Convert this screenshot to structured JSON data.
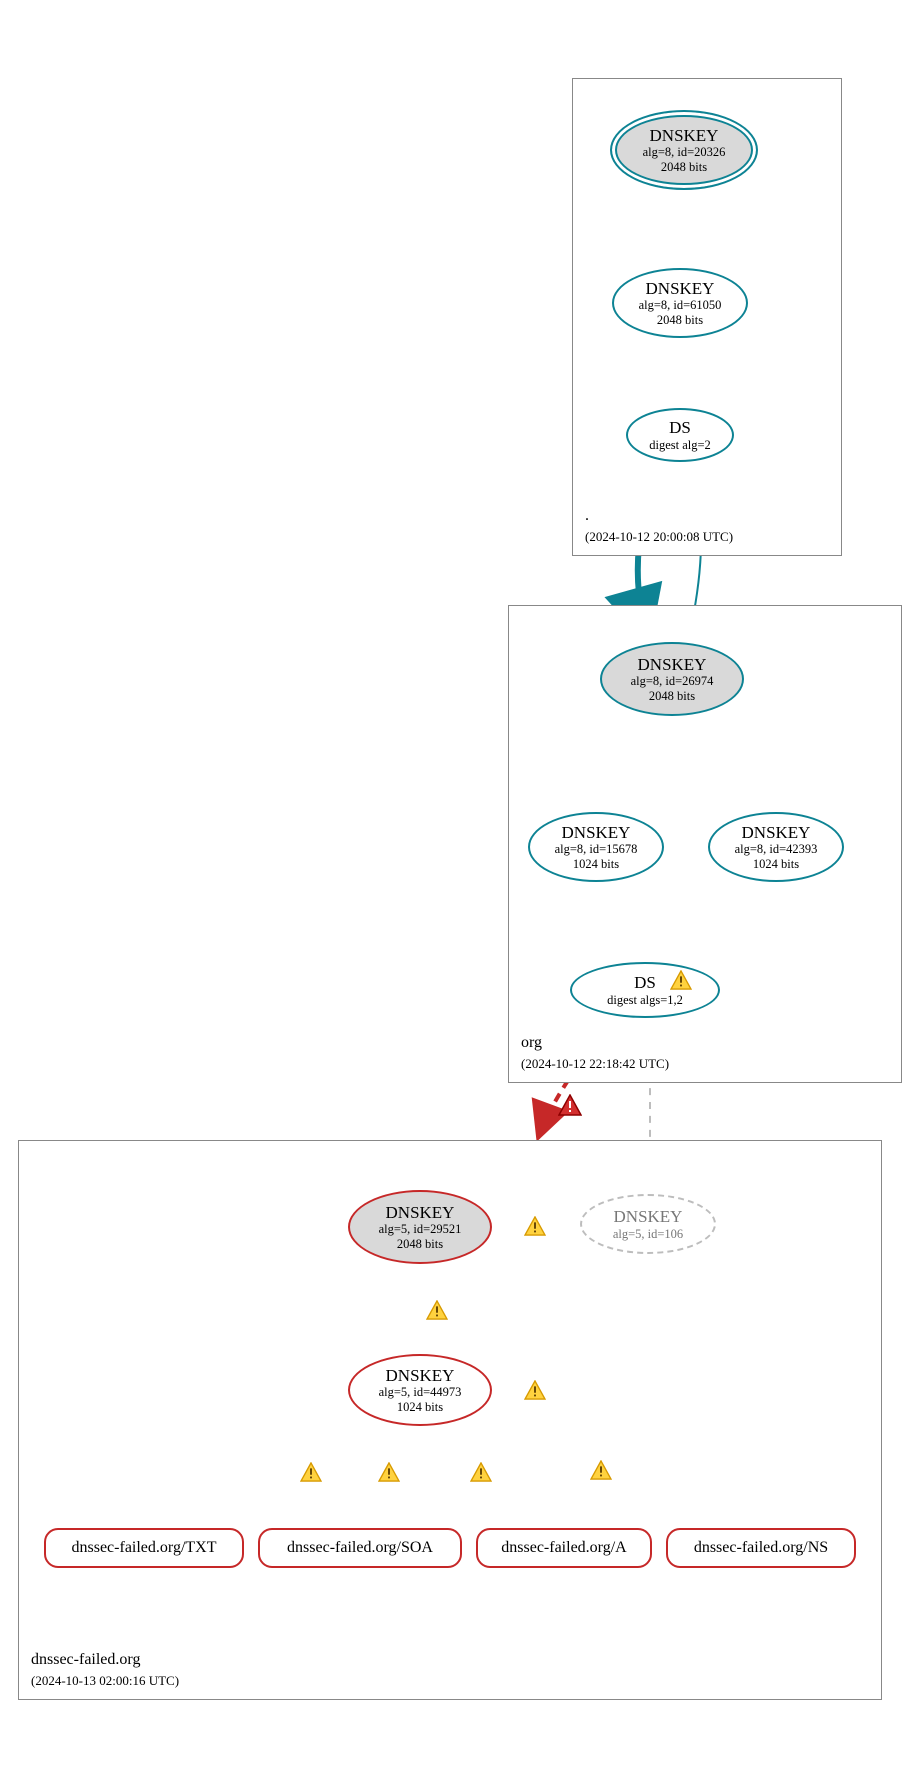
{
  "zones": {
    "root": {
      "name": ".",
      "timestamp": "(2024-10-12 20:00:08 UTC)"
    },
    "org": {
      "name": "org",
      "timestamp": "(2024-10-12 22:18:42 UTC)"
    },
    "failed": {
      "name": "dnssec-failed.org",
      "timestamp": "(2024-10-13 02:00:16 UTC)"
    }
  },
  "nodes": {
    "root_ksk": {
      "title": "DNSKEY",
      "line1": "alg=8, id=20326",
      "line2": "2048 bits"
    },
    "root_zsk": {
      "title": "DNSKEY",
      "line1": "alg=8, id=61050",
      "line2": "2048 bits"
    },
    "root_ds": {
      "title": "DS",
      "line1": "digest alg=2",
      "line2": ""
    },
    "org_ksk": {
      "title": "DNSKEY",
      "line1": "alg=8, id=26974",
      "line2": "2048 bits"
    },
    "org_zsk1": {
      "title": "DNSKEY",
      "line1": "alg=8, id=15678",
      "line2": "1024 bits"
    },
    "org_zsk2": {
      "title": "DNSKEY",
      "line1": "alg=8, id=42393",
      "line2": "1024 bits"
    },
    "org_ds": {
      "title": "DS",
      "line1": "digest algs=1,2",
      "line2": ""
    },
    "fail_ksk": {
      "title": "DNSKEY",
      "line1": "alg=5, id=29521",
      "line2": "2048 bits"
    },
    "fail_zsk": {
      "title": "DNSKEY",
      "line1": "alg=5, id=44973",
      "line2": "1024 bits"
    },
    "fail_missing": {
      "title": "DNSKEY",
      "line1": "alg=5, id=106",
      "line2": ""
    }
  },
  "rrsets": {
    "txt": "dnssec-failed.org/TXT",
    "soa": "dnssec-failed.org/SOA",
    "a": "dnssec-failed.org/A",
    "ns": "dnssec-failed.org/NS"
  },
  "colors": {
    "teal": "#0d8394",
    "red": "#c62828",
    "gray": "#bdbdbd",
    "warn_fill": "#ffd23f",
    "warn_stroke": "#d79a00",
    "err_fill": "#d32f2f"
  }
}
